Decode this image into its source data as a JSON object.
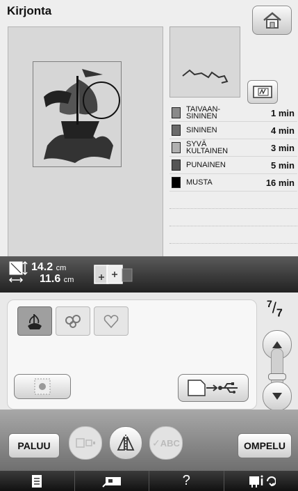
{
  "header": {
    "title": "Kirjonta"
  },
  "colors": [
    {
      "name": "TAIVAAN-\nSININEN",
      "time": "1 min",
      "swatch": "#8a8a8a"
    },
    {
      "name": "SININEN",
      "time": "4 min",
      "swatch": "#6a6a6a"
    },
    {
      "name": "SYVÄ\nKULTAINEN",
      "time": "3 min",
      "swatch": "#b0b0b0"
    },
    {
      "name": "PUNAINEN",
      "time": "5 min",
      "swatch": "#555555"
    },
    {
      "name": "MUSTA",
      "time": "16 min",
      "swatch": "#000000"
    }
  ],
  "size": {
    "height_value": "14.2",
    "height_unit": "cm",
    "width_value": "11.6",
    "width_unit": "cm"
  },
  "pager": {
    "current": "7",
    "total": "7"
  },
  "buttons": {
    "back": "PALUU",
    "sew": "OMPELU",
    "abc": "ABC"
  },
  "icons": [
    "home-icon",
    "trace-icon",
    "size-icon",
    "frame-size-icon",
    "usb-save-icon",
    "arrow-up-icon",
    "arrow-down-icon",
    "repeat-icon",
    "mirror-icon",
    "document-icon",
    "embroidery-unit-icon",
    "help-icon",
    "settings-icon"
  ]
}
